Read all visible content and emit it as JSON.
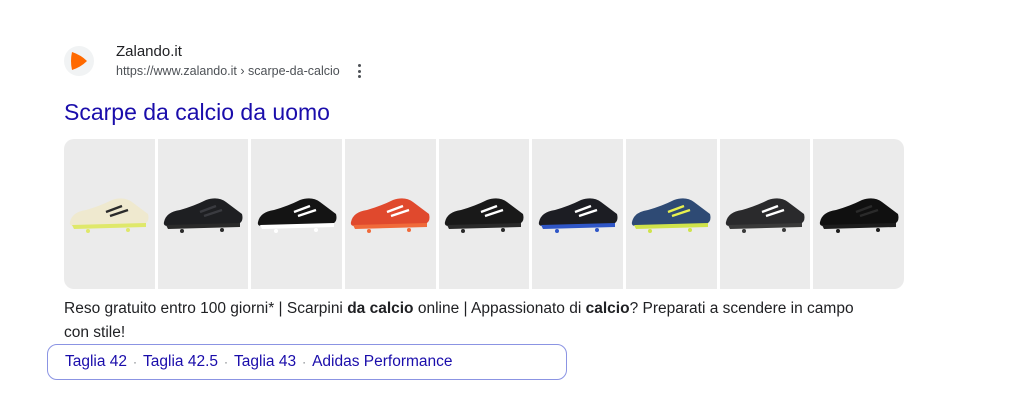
{
  "site": {
    "name": "Zalando.it",
    "url": "https://www.zalando.it › scarpe-da-calcio",
    "favicon": "zalando-logo"
  },
  "title": "Scarpe da calcio da uomo",
  "images": [
    {
      "name": "shoe-white-yellow",
      "color": "#efe9cf",
      "accent": "#2b2b2b",
      "sole": "#dfe86a"
    },
    {
      "name": "shoe-black-1",
      "color": "#1e1f22",
      "accent": "#3a3b40",
      "sole": "#2a2a2a"
    },
    {
      "name": "shoe-black-white-stripes",
      "color": "#141414",
      "accent": "#ffffff",
      "sole": "#ffffff"
    },
    {
      "name": "shoe-red-orange",
      "color": "#e0492d",
      "accent": "#ffffff",
      "sole": "#f06a3a"
    },
    {
      "name": "shoe-black-2",
      "color": "#191919",
      "accent": "#ffffff",
      "sole": "#2a2a2a"
    },
    {
      "name": "shoe-black-blue",
      "color": "#1c1d23",
      "accent": "#ffffff",
      "sole": "#2f56c7"
    },
    {
      "name": "shoe-blue-yellow",
      "color": "#2e4a74",
      "accent": "#e7f04f",
      "sole": "#cfe34a"
    },
    {
      "name": "shoe-black-3",
      "color": "#2a2a2c",
      "accent": "#ffffff",
      "sole": "#3a3a3a"
    },
    {
      "name": "shoe-black-4",
      "color": "#101010",
      "accent": "#2a2a2a",
      "sole": "#1d1d1d"
    }
  ],
  "snippet": {
    "p1": "Reso gratuito entro 100 giorni* | Scarpini ",
    "b1": "da calcio",
    "p2": " online | Appassionato di ",
    "b2": "calcio",
    "p3": "? Preparati a scendere in campo con stile!"
  },
  "sitelinks": [
    "Taglia 42",
    "Taglia 42.5",
    "Taglia 43",
    "Adidas Performance"
  ],
  "sitelink_separator": "·",
  "colors": {
    "link": "#1a0dab",
    "favicon_orange": "#ff6900",
    "border": "#8b94e3"
  }
}
